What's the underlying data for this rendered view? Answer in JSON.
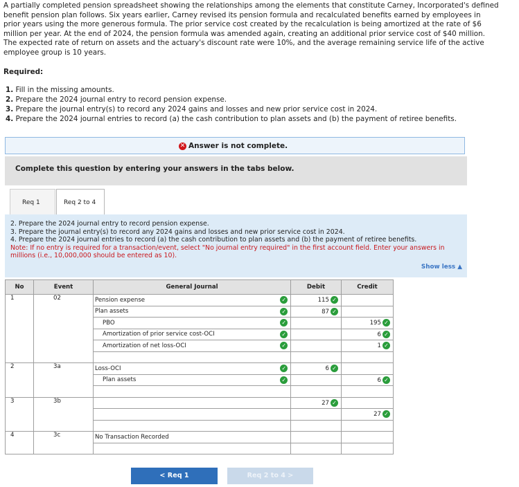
{
  "intro": "A partially completed pension spreadsheet showing the relationships among the elements that constitute Carney, Incorporated's defined benefit pension plan follows. Six years earlier, Carney revised its pension formula and recalculated benefits earned by employees in prior years using the more generous formula. The prior service cost created by the recalculation is being amortized at the rate of $6 million per year. At the end of 2024, the pension formula was amended again, creating an additional prior service cost of $40 million. The expected rate of return on assets and the actuary's discount rate were 10%, and the average remaining service life of the active employee group is 10 years.",
  "required_label": "Required:",
  "requirements": [
    {
      "num": "1.",
      "text": "Fill in the missing amounts."
    },
    {
      "num": "2.",
      "text": "Prepare the 2024 journal entry to record pension expense."
    },
    {
      "num": "3.",
      "text": "Prepare the journal entry(s) to record any 2024 gains and losses and new prior service cost in 2024."
    },
    {
      "num": "4.",
      "text": "Prepare the 2024 journal entries to record (a) the cash contribution to plan assets and (b) the payment of retiree benefits."
    }
  ],
  "notice": "Answer is not complete.",
  "complete_prompt": "Complete this question by entering your answers in the tabs below.",
  "tabs": [
    "Req 1",
    "Req 2 to 4"
  ],
  "instructions": {
    "line1": "2. Prepare the 2024 journal entry to record pension expense.",
    "line2": "3. Prepare the journal entry(s) to record any 2024 gains and losses and new prior service cost in 2024.",
    "line3": "4. Prepare the 2024 journal entries to record (a) the cash contribution to plan assets and (b) the payment of retiree benefits.",
    "note": "Note: If no entry is required for a transaction/event, select \"No journal entry required\" in the first account field. Enter your answers in millions (i.e., 10,000,000 should be entered as 10)."
  },
  "show_less": "Show less ▲",
  "table": {
    "headers": {
      "no": "No",
      "event": "Event",
      "journal": "General Journal",
      "debit": "Debit",
      "credit": "Credit"
    },
    "groups": [
      {
        "no": "1",
        "event": "02",
        "rows": [
          {
            "account": "Pension expense",
            "indent": false,
            "debit": "115",
            "credit": "",
            "checked": true
          },
          {
            "account": "Plan assets",
            "indent": false,
            "debit": "87",
            "credit": "",
            "checked": true
          },
          {
            "account": "PBO",
            "indent": true,
            "debit": "",
            "credit": "195",
            "checked": true
          },
          {
            "account": "Amortization of prior service cost-OCI",
            "indent": true,
            "debit": "",
            "credit": "6",
            "checked": true
          },
          {
            "account": "Amortization of net loss-OCI",
            "indent": true,
            "debit": "",
            "credit": "1",
            "checked": true
          },
          {
            "account": "",
            "indent": false,
            "debit": "",
            "credit": "",
            "checked": false
          }
        ]
      },
      {
        "no": "2",
        "event": "3a",
        "rows": [
          {
            "account": "Loss-OCI",
            "indent": false,
            "debit": "6",
            "credit": "",
            "checked": true
          },
          {
            "account": "Plan assets",
            "indent": true,
            "debit": "",
            "credit": "6",
            "checked": true
          },
          {
            "account": "",
            "indent": false,
            "debit": "",
            "credit": "",
            "checked": false
          }
        ]
      },
      {
        "no": "3",
        "event": "3b",
        "rows": [
          {
            "account": "",
            "indent": false,
            "debit": "27",
            "credit": "",
            "checked": false
          },
          {
            "account": "",
            "indent": false,
            "debit": "",
            "credit": "27",
            "checked": false
          },
          {
            "account": "",
            "indent": false,
            "debit": "",
            "credit": "",
            "checked": false
          }
        ]
      },
      {
        "no": "4",
        "event": "3c",
        "rows": [
          {
            "account": "No Transaction Recorded",
            "indent": false,
            "debit": "",
            "credit": "",
            "checked": false
          },
          {
            "account": "",
            "indent": false,
            "debit": "",
            "credit": "",
            "checked": false
          }
        ]
      }
    ]
  },
  "nav": {
    "prev": "< Req 1",
    "next": "Req 2 to 4 >"
  },
  "colors": {
    "check_green": "#2a9d3b",
    "error_red": "#d0161b",
    "link_blue": "#3a75c4",
    "button_blue": "#2f6fba"
  }
}
